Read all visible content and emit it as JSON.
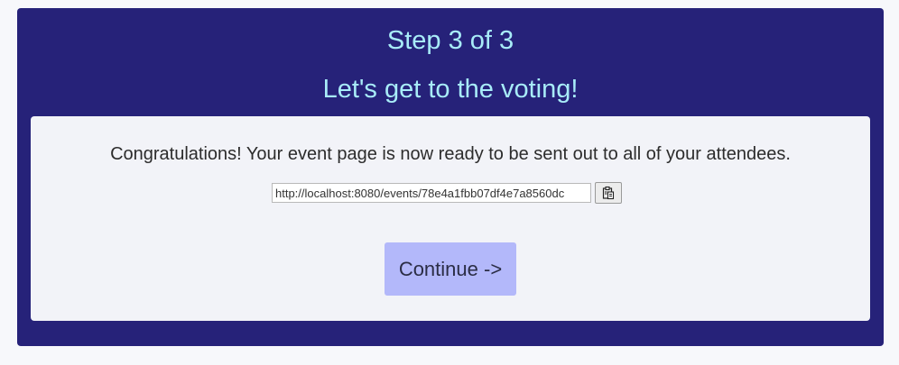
{
  "header": {
    "step": "Step 3 of 3",
    "subtitle": "Let's get to the voting!"
  },
  "card": {
    "message": "Congratulations! Your event page is now ready to be sent out to all of your attendees.",
    "event_link": "http://localhost:8080/events/78e4a1fbb07df4e7a8560dc",
    "copy_icon": "clipboard-icon",
    "continue_label": "Continue ->"
  },
  "colors": {
    "page_background": "#f7f8fb",
    "panel_background": "#262279",
    "heading_text": "#a8ecf8",
    "card_background": "#f2f3f8",
    "continue_button": "#b3b8fa"
  }
}
